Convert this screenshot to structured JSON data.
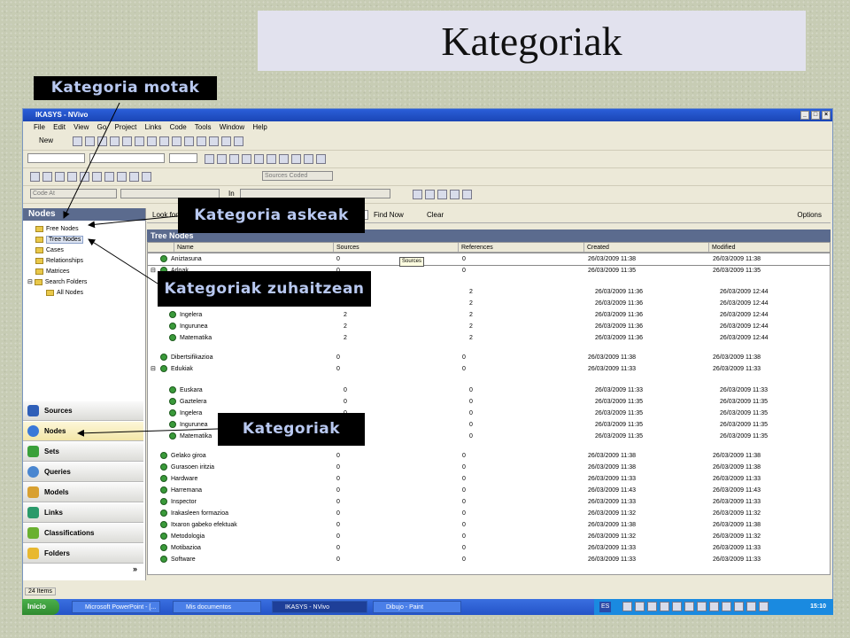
{
  "slide": {
    "title": "Kategoriak",
    "callouts": {
      "types": "Kategoria motak",
      "free": "Kategoria askeak",
      "tree": "Kategoriak zuhaitzean",
      "cats": "Kategoriak"
    }
  },
  "window": {
    "title": "IKASYS - NVivo",
    "controls": [
      "_",
      "□",
      "×"
    ],
    "menu": [
      "File",
      "Edit",
      "View",
      "Go",
      "Project",
      "Links",
      "Code",
      "Tools",
      "Window",
      "Help"
    ],
    "toolbar": {
      "new_label": "New",
      "sources_coded": "Sources Coded",
      "code_at": "Code At",
      "in_label": "In"
    }
  },
  "left_panel": {
    "header": "Nodes",
    "tree": [
      "Free Nodes",
      "Tree Nodes",
      "Cases",
      "Relationships",
      "Matrices",
      "Search Folders",
      "All Nodes"
    ],
    "nav": [
      "Sources",
      "Nodes",
      "Sets",
      "Queries",
      "Models",
      "Links",
      "Classifications",
      "Folders"
    ],
    "status": "24 Items"
  },
  "find_bar": {
    "look_for": "Look for",
    "find_now": "Find Now",
    "clear": "Clear",
    "options": "Options"
  },
  "tree_nodes": {
    "header": "Tree Nodes",
    "columns": [
      "Name",
      "Sources",
      "References",
      "Created",
      "Modified"
    ],
    "tooltip": "Sources",
    "rows": [
      {
        "name": "Aniztasuna",
        "sources": "0",
        "refs": "0",
        "created": "26/03/2009 11:38",
        "modified": "26/03/2009 11:38",
        "level": 0
      },
      {
        "name": "Arloak",
        "sources": "0",
        "refs": "0",
        "created": "26/03/2009 11:35",
        "modified": "26/03/2009 11:35",
        "level": 0
      },
      {
        "name": "Euskara",
        "sources": "2",
        "refs": "2",
        "created": "26/03/2009 11:36",
        "modified": "26/03/2009 12:44",
        "level": 1
      },
      {
        "name": "Gaztelera",
        "sources": "2",
        "refs": "2",
        "created": "26/03/2009 11:36",
        "modified": "26/03/2009 12:44",
        "level": 1
      },
      {
        "name": "Ingelera",
        "sources": "2",
        "refs": "2",
        "created": "26/03/2009 11:36",
        "modified": "26/03/2009 12:44",
        "level": 1
      },
      {
        "name": "Ingurunea",
        "sources": "2",
        "refs": "2",
        "created": "26/03/2009 11:36",
        "modified": "26/03/2009 12:44",
        "level": 1
      },
      {
        "name": "Matematika",
        "sources": "2",
        "refs": "2",
        "created": "26/03/2009 11:36",
        "modified": "26/03/2009 12:44",
        "level": 1
      },
      {
        "name": "Dibertsifikazioa",
        "sources": "0",
        "refs": "0",
        "created": "26/03/2009 11:38",
        "modified": "26/03/2009 11:38",
        "level": 0
      },
      {
        "name": "Edukiak",
        "sources": "0",
        "refs": "0",
        "created": "26/03/2009 11:33",
        "modified": "26/03/2009 11:33",
        "level": 0
      },
      {
        "name": "Euskara",
        "sources": "0",
        "refs": "0",
        "created": "26/03/2009 11:33",
        "modified": "26/03/2009 11:33",
        "level": 1
      },
      {
        "name": "Gaztelera",
        "sources": "0",
        "refs": "0",
        "created": "26/03/2009 11:35",
        "modified": "26/03/2009 11:35",
        "level": 1
      },
      {
        "name": "Ingelera",
        "sources": "0",
        "refs": "0",
        "created": "26/03/2009 11:35",
        "modified": "26/03/2009 11:35",
        "level": 1
      },
      {
        "name": "Ingurunea",
        "sources": "0",
        "refs": "0",
        "created": "26/03/2009 11:35",
        "modified": "26/03/2009 11:35",
        "level": 1
      },
      {
        "name": "Matematika",
        "sources": "0",
        "refs": "0",
        "created": "26/03/2009 11:35",
        "modified": "26/03/2009 11:35",
        "level": 1
      },
      {
        "name": "Gelako giroa",
        "sources": "0",
        "refs": "0",
        "created": "26/03/2009 11:38",
        "modified": "26/03/2009 11:38",
        "level": 0
      },
      {
        "name": "Gurasoen iritzia",
        "sources": "0",
        "refs": "0",
        "created": "26/03/2009 11:38",
        "modified": "26/03/2009 11:38",
        "level": 0
      },
      {
        "name": "Hardware",
        "sources": "0",
        "refs": "0",
        "created": "26/03/2009 11:33",
        "modified": "26/03/2009 11:33",
        "level": 0
      },
      {
        "name": "Harremana",
        "sources": "0",
        "refs": "0",
        "created": "26/03/2009 11:43",
        "modified": "26/03/2009 11:43",
        "level": 0
      },
      {
        "name": "Inspector",
        "sources": "0",
        "refs": "0",
        "created": "26/03/2009 11:33",
        "modified": "26/03/2009 11:33",
        "level": 0
      },
      {
        "name": "Irakasleen formazioa",
        "sources": "0",
        "refs": "0",
        "created": "26/03/2009 11:32",
        "modified": "26/03/2009 11:32",
        "level": 0
      },
      {
        "name": "Itxaron gabeko efektuak",
        "sources": "0",
        "refs": "0",
        "created": "26/03/2009 11:38",
        "modified": "26/03/2009 11:38",
        "level": 0
      },
      {
        "name": "Metodologia",
        "sources": "0",
        "refs": "0",
        "created": "26/03/2009 11:32",
        "modified": "26/03/2009 11:32",
        "level": 0
      },
      {
        "name": "Motibazioa",
        "sources": "0",
        "refs": "0",
        "created": "26/03/2009 11:33",
        "modified": "26/03/2009 11:33",
        "level": 0
      },
      {
        "name": "Software",
        "sources": "0",
        "refs": "0",
        "created": "26/03/2009 11:33",
        "modified": "26/03/2009 11:33",
        "level": 0
      }
    ]
  },
  "taskbar": {
    "start": "Inicio",
    "tasks": [
      "Microsoft PowerPoint - [...",
      "Mis documentos",
      "IKASYS - NVivo",
      "Dibujo - Paint"
    ],
    "lang": "ES",
    "clock": "15:10"
  },
  "colors": {
    "slide_bg": "#c7ccb4",
    "callout_bg": "#000000",
    "callout_text": "#b8c8f0",
    "panel_header": "#5b6b8e",
    "xp_blue": "#2454c8"
  }
}
